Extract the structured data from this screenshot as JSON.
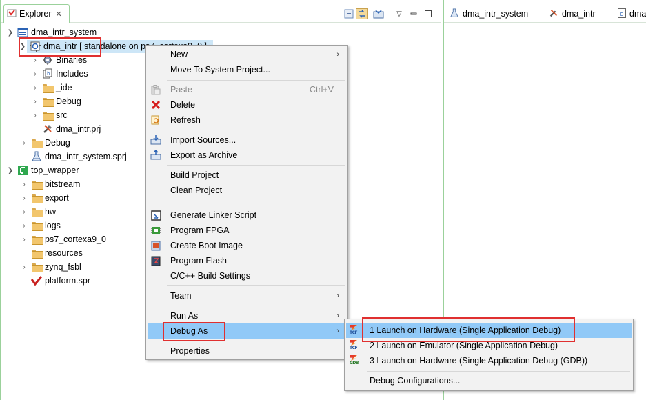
{
  "explorer": {
    "tab_label": "Explorer",
    "tree": [
      {
        "label": "dma_intr_system",
        "level": 0,
        "expanded": true,
        "icon": "system-project-icon"
      },
      {
        "label": "dma_intr [ standalone on ps7_cortexa9_0 ]",
        "level": 1,
        "expanded": true,
        "icon": "application-project-icon",
        "selected": true
      },
      {
        "label": "Binaries",
        "level": 2,
        "expanded": false,
        "icon": "binaries-icon"
      },
      {
        "label": "Includes",
        "level": 2,
        "expanded": false,
        "icon": "includes-icon"
      },
      {
        "label": "_ide",
        "level": 2,
        "expanded": false,
        "icon": "folder-icon"
      },
      {
        "label": "Debug",
        "level": 2,
        "expanded": false,
        "icon": "folder-icon"
      },
      {
        "label": "src",
        "level": 2,
        "expanded": false,
        "icon": "folder-icon"
      },
      {
        "label": "dma_intr.prj",
        "level": 2,
        "icon": "prj-file-icon"
      },
      {
        "label": "Debug",
        "level": 1,
        "expanded": false,
        "icon": "folder-icon"
      },
      {
        "label": "dma_intr_system.sprj",
        "level": 1,
        "icon": "sprj-file-icon"
      },
      {
        "label": "top_wrapper",
        "level": 0,
        "expanded": true,
        "icon": "platform-project-icon"
      },
      {
        "label": "bitstream",
        "level": 1,
        "expanded": false,
        "icon": "folder-icon"
      },
      {
        "label": "export",
        "level": 1,
        "expanded": false,
        "icon": "folder-icon"
      },
      {
        "label": "hw",
        "level": 1,
        "expanded": false,
        "icon": "folder-icon"
      },
      {
        "label": "logs",
        "level": 1,
        "expanded": false,
        "icon": "folder-icon"
      },
      {
        "label": "ps7_cortexa9_0",
        "level": 1,
        "expanded": false,
        "icon": "folder-icon"
      },
      {
        "label": "resources",
        "level": 1,
        "icon": "folder-icon"
      },
      {
        "label": "zynq_fsbl",
        "level": 1,
        "expanded": false,
        "icon": "folder-icon"
      },
      {
        "label": "platform.spr",
        "level": 1,
        "icon": "spr-file-icon"
      }
    ]
  },
  "editor": {
    "tabs": [
      {
        "label": "dma_intr_system",
        "icon": "sprj-file-icon"
      },
      {
        "label": "dma_intr",
        "icon": "prj-file-icon"
      },
      {
        "label": "dma",
        "icon": "c-file-icon"
      }
    ]
  },
  "context_menu": {
    "items": [
      {
        "label": "New",
        "submenu": true
      },
      {
        "label": "Move To System Project..."
      },
      {
        "separator": true
      },
      {
        "label": "Paste",
        "shortcut": "Ctrl+V",
        "disabled": true,
        "icon": "paste-icon"
      },
      {
        "label": "Delete",
        "icon": "delete-icon"
      },
      {
        "label": "Refresh",
        "icon": "refresh-icon"
      },
      {
        "separator": true
      },
      {
        "label": "Import Sources...",
        "icon": "import-icon"
      },
      {
        "label": "Export as Archive",
        "icon": "export-icon"
      },
      {
        "separator": true
      },
      {
        "label": "Build Project"
      },
      {
        "label": "Clean Project"
      },
      {
        "separator": true
      },
      {
        "label": "Generate Linker Script",
        "icon": "linker-script-icon"
      },
      {
        "label": "Program FPGA",
        "icon": "program-fpga-icon"
      },
      {
        "label": "Create Boot Image",
        "icon": "boot-image-icon"
      },
      {
        "label": "Program Flash",
        "icon": "program-flash-icon"
      },
      {
        "label": "C/C++ Build Settings"
      },
      {
        "separator": true
      },
      {
        "label": "Team",
        "submenu": true
      },
      {
        "separator": true
      },
      {
        "label": "Run As",
        "submenu": true
      },
      {
        "label": "Debug As",
        "submenu": true,
        "highlighted": true
      },
      {
        "separator": true
      },
      {
        "label": "Properties"
      }
    ]
  },
  "debug_submenu": {
    "items": [
      {
        "label": "1 Launch on Hardware (Single Application Debug)",
        "icon": "tcf-icon",
        "icon_text": "TCF",
        "highlighted": true
      },
      {
        "label": "2 Launch on Emulator (Single Application Debug)",
        "icon": "tcf-icon",
        "icon_text": "TCF"
      },
      {
        "label": "3 Launch on Hardware (Single Application Debug (GDB))",
        "icon": "gdb-icon",
        "icon_text": "GDB"
      },
      {
        "separator": true
      },
      {
        "label": "Debug Configurations..."
      }
    ]
  },
  "colors": {
    "highlight": "#91c9f7",
    "annotation": "#e03030",
    "selection": "#cde6f7"
  }
}
